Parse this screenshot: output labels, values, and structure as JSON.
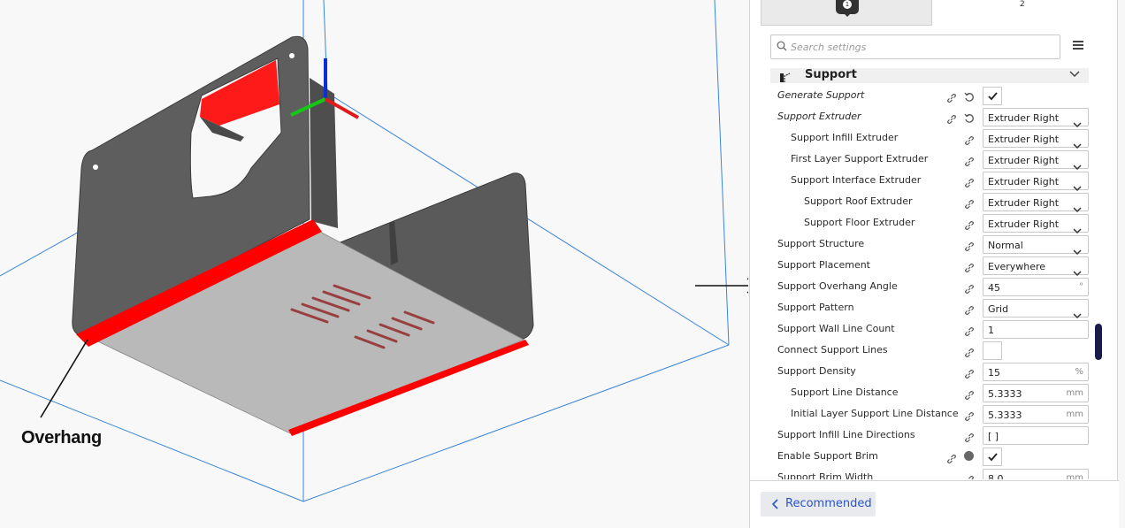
{
  "viewport": {
    "callout_label": "Overhang"
  },
  "panel": {
    "tabs": [
      {
        "label": "1",
        "icon": "extruder-icon"
      },
      {
        "label": "2"
      }
    ],
    "search": {
      "placeholder": "Search settings",
      "icon": "search-icon"
    },
    "menu_icon": "hamburger-menu-icon",
    "section": {
      "title": "Support",
      "icon": "support-icon",
      "chevron": "chevron-down-icon"
    },
    "rows": [
      {
        "label": "Generate Support",
        "italic": true,
        "indent": 0,
        "link": true,
        "reset": true,
        "type": "checkbox",
        "checked": true
      },
      {
        "label": "Support Extruder",
        "italic": true,
        "indent": 0,
        "link": true,
        "reset": true,
        "type": "select",
        "value": "Extruder Right"
      },
      {
        "label": "Support Infill Extruder",
        "indent": 1,
        "link": true,
        "type": "select",
        "value": "Extruder Right"
      },
      {
        "label": "First Layer Support Extruder",
        "indent": 1,
        "link": true,
        "type": "select",
        "value": "Extruder Right"
      },
      {
        "label": "Support Interface Extruder",
        "indent": 1,
        "link": true,
        "type": "select",
        "value": "Extruder Right"
      },
      {
        "label": "Support Roof Extruder",
        "indent": 2,
        "link": true,
        "type": "select",
        "value": "Extruder Right"
      },
      {
        "label": "Support Floor Extruder",
        "indent": 2,
        "link": true,
        "type": "select",
        "value": "Extruder Right"
      },
      {
        "label": "Support Structure",
        "indent": 0,
        "link": true,
        "type": "select",
        "value": "Normal"
      },
      {
        "label": "Support Placement",
        "indent": 0,
        "link": true,
        "type": "select",
        "value": "Everywhere"
      },
      {
        "label": "Support Overhang Angle",
        "indent": 0,
        "link": true,
        "type": "number",
        "value": "45",
        "unit": "°"
      },
      {
        "label": "Support Pattern",
        "indent": 0,
        "link": true,
        "type": "select",
        "value": "Grid"
      },
      {
        "label": "Support Wall Line Count",
        "indent": 0,
        "link": true,
        "type": "number",
        "value": "1",
        "unit": ""
      },
      {
        "label": "Connect Support Lines",
        "indent": 0,
        "link": true,
        "type": "checkbox",
        "checked": false
      },
      {
        "label": "Support Density",
        "indent": 0,
        "link": true,
        "type": "number",
        "value": "15",
        "unit": "%"
      },
      {
        "label": "Support Line Distance",
        "indent": 1,
        "link": true,
        "type": "number",
        "value": "5.3333",
        "unit": "mm"
      },
      {
        "label": "Initial Layer Support Line Distance",
        "indent": 1,
        "link": true,
        "type": "number",
        "value": "5.3333",
        "unit": "mm"
      },
      {
        "label": "Support Infill Line Directions",
        "indent": 0,
        "link": true,
        "type": "number",
        "value": "[ ]",
        "unit": ""
      },
      {
        "label": "Enable Support Brim",
        "indent": 0,
        "link": true,
        "info": true,
        "type": "checkbox",
        "checked": true
      },
      {
        "label": "Support Brim Width",
        "indent": 0,
        "link": true,
        "type": "number",
        "value": "8.0",
        "unit": "mm"
      }
    ],
    "footer": {
      "recommended_label": "Recommended",
      "icon": "chevron-left-icon"
    }
  },
  "colors": {
    "overhang": "#ff0000",
    "model": "#5f5f5f",
    "bottom": "#b8b8b8",
    "build_volume": "#2f7fd6",
    "accent": "#2a55c8",
    "scroll": "#1a1d4a"
  }
}
